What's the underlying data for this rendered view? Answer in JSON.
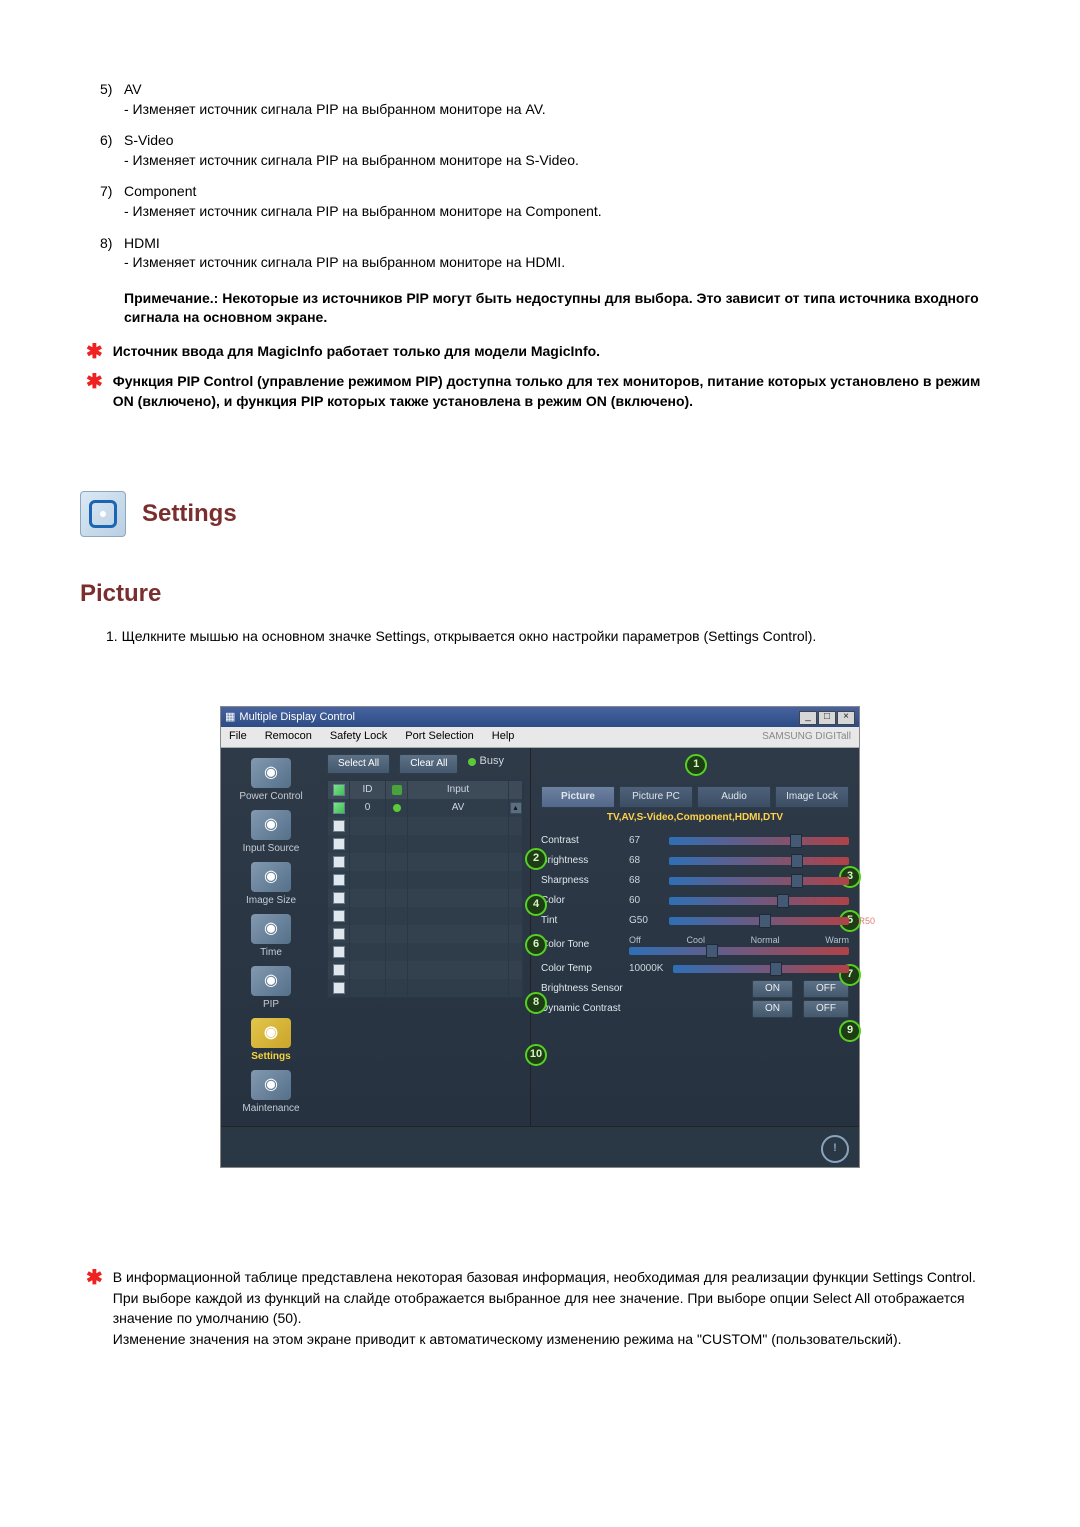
{
  "list": {
    "items": [
      {
        "ord": "5)",
        "title": "AV",
        "desc": "- Изменяет источник сигнала PIP на выбранном мониторе на AV."
      },
      {
        "ord": "6)",
        "title": "S-Video",
        "desc": "- Изменяет источник сигнала PIP на выбранном мониторе на S-Video."
      },
      {
        "ord": "7)",
        "title": "Component",
        "desc": "- Изменяет источник сигнала PIP на выбранном мониторе на Component."
      },
      {
        "ord": "8)",
        "title": "HDMI",
        "desc": "- Изменяет источник сигнала PIP на выбранном мониторе на HDMI."
      }
    ],
    "note_bold": "Примечание.: Некоторые из источников PIP могут быть недоступны для выбора. Это зависит от типа источника входного сигнала на основном экране."
  },
  "star_notes": [
    "Источник ввода для MagicInfo работает только для модели MagicInfo.",
    "Функция PIP Control (управление режимом PIP) доступна только для тех мониторов, питание которых установлено в режим ON (включено), и функция PIP которых также установлена в режим ON (включено)."
  ],
  "settings_heading": "Settings",
  "picture_heading": "Picture",
  "picture_step": {
    "ord": "1.",
    "text": "Щелкните мышью на основном значке Settings, открывается окно настройки параметров (Settings Control)."
  },
  "app": {
    "title": "Multiple Display Control",
    "menus": [
      "File",
      "Remocon",
      "Safety Lock",
      "Port Selection",
      "Help"
    ],
    "brand": "SAMSUNG DIGITall",
    "sidebar": [
      {
        "label": "Power Control",
        "sel": false
      },
      {
        "label": "Input Source",
        "sel": false
      },
      {
        "label": "Image Size",
        "sel": false
      },
      {
        "label": "Time",
        "sel": false
      },
      {
        "label": "PIP",
        "sel": false
      },
      {
        "label": "Settings",
        "sel": true
      },
      {
        "label": "Maintenance",
        "sel": false
      }
    ],
    "buttons": {
      "select_all": "Select All",
      "clear_all": "Clear All",
      "busy": "Busy"
    },
    "table": {
      "headers": {
        "id": "ID",
        "input": "Input"
      },
      "rows": [
        {
          "checked": true,
          "id": "0",
          "status": "on",
          "input": "AV"
        },
        {
          "checked": false,
          "id": "",
          "status": "",
          "input": ""
        },
        {
          "checked": false,
          "id": "",
          "status": "",
          "input": ""
        },
        {
          "checked": false,
          "id": "",
          "status": "",
          "input": ""
        },
        {
          "checked": false,
          "id": "",
          "status": "",
          "input": ""
        },
        {
          "checked": false,
          "id": "",
          "status": "",
          "input": ""
        },
        {
          "checked": false,
          "id": "",
          "status": "",
          "input": ""
        },
        {
          "checked": false,
          "id": "",
          "status": "",
          "input": ""
        },
        {
          "checked": false,
          "id": "",
          "status": "",
          "input": ""
        },
        {
          "checked": false,
          "id": "",
          "status": "",
          "input": ""
        },
        {
          "checked": false,
          "id": "",
          "status": "",
          "input": ""
        }
      ]
    },
    "tabs": [
      "Picture",
      "Picture PC",
      "Audio",
      "Image Lock"
    ],
    "subtitle": "TV,AV,S-Video,Component,HDMI,DTV",
    "sliders": [
      {
        "label": "Contrast",
        "value": "67",
        "pos": 67
      },
      {
        "label": "Brightness",
        "value": "68",
        "pos": 68
      },
      {
        "label": "Sharpness",
        "value": "68",
        "pos": 68
      },
      {
        "label": "Color",
        "value": "60",
        "pos": 60
      },
      {
        "label": "Tint",
        "value": "G50",
        "pos": 50,
        "right": "R50"
      }
    ],
    "color_tone": {
      "label": "Color Tone",
      "options": [
        "Off",
        "Cool",
        "Normal",
        "Warm"
      ],
      "pos": 35
    },
    "color_temp": {
      "label": "Color Temp",
      "value": "10000K",
      "pos": 55
    },
    "toggles": [
      {
        "label": "Brightness Sensor",
        "on": "ON",
        "off": "OFF"
      },
      {
        "label": "Dynamic Contrast",
        "on": "ON",
        "off": "OFF"
      }
    ]
  },
  "bottom_note": {
    "p1": "В информационной таблице представлена некоторая базовая информация, необходимая для реализации функции Settings Control.",
    "p2": "При выборе каждой из функций на слайде отображается выбранное для нее значение. При выборе опции Select All отображается значение по умолчанию (50).",
    "p3": "Изменение значения на этом экране приводит к автоматическому изменению режима на \"CUSTOM\" (пользовательский)."
  }
}
